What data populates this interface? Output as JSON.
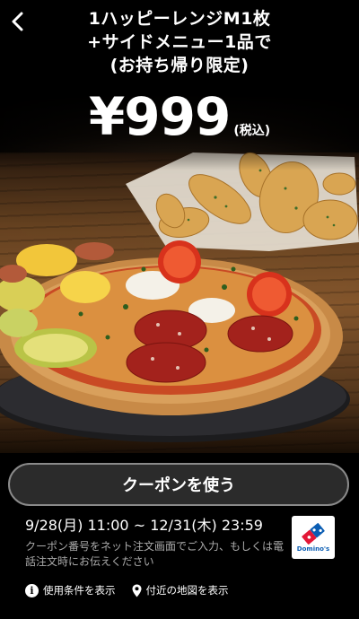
{
  "header": {
    "back_icon": "chevron-left-icon",
    "title_lines": [
      "1ハッピーレンジM1枚",
      "+サイドメニュー1品で",
      "(お持ち帰り限定)"
    ]
  },
  "offer": {
    "price": "¥999",
    "tax_note": "(税込)"
  },
  "actions": {
    "use_coupon_label": "クーポンを使う"
  },
  "validity": {
    "period": "9/28(月) 11:00 ~ 12/31(木) 23:59"
  },
  "brand": {
    "logo_text": "Domino's",
    "logo_color": "#0a5db3",
    "logo_accent": "#e31837"
  },
  "instructions": {
    "text": "クーポン番号をネット注文画面でご入力、もしくは電話注文時にお伝えください"
  },
  "footer": {
    "terms_label": "使用条件を表示",
    "terms_icon": "info-icon",
    "map_label": "付近の地図を表示",
    "map_icon": "map-pin-icon"
  }
}
